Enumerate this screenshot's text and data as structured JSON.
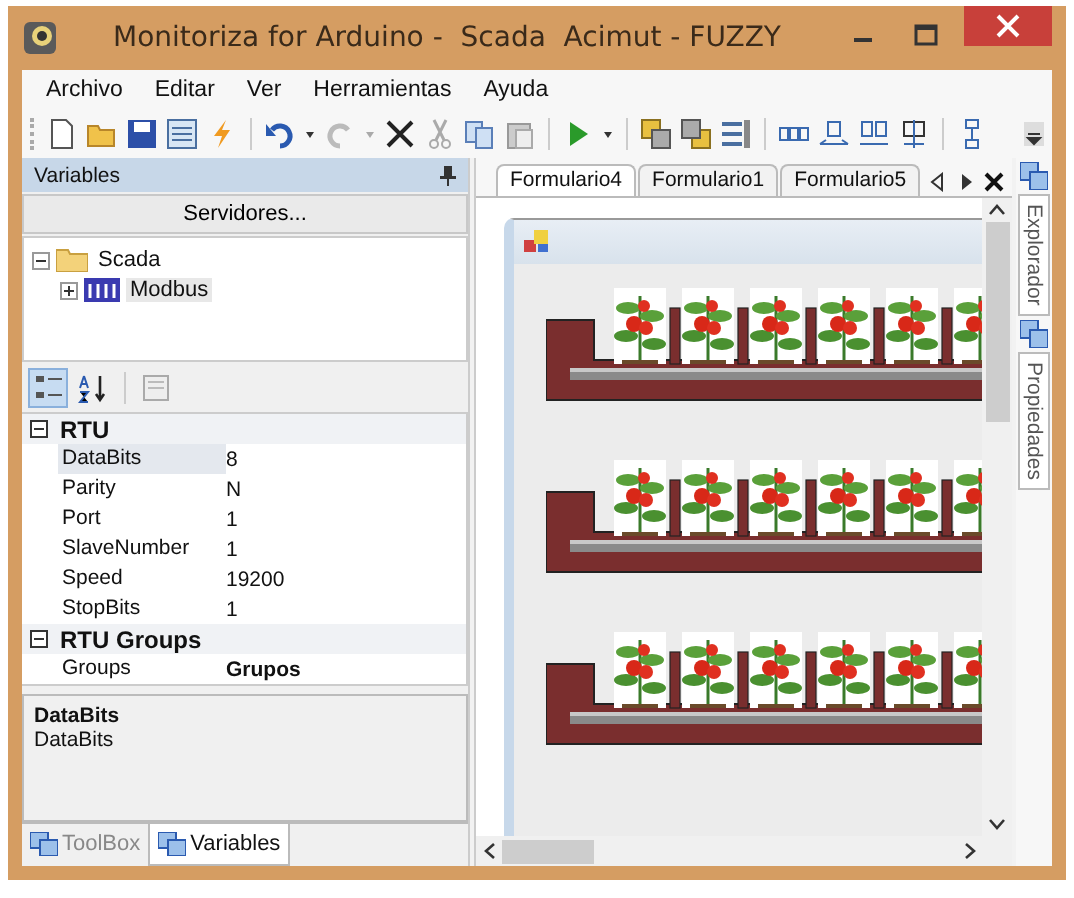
{
  "window": {
    "title": "Monitoriza for Arduino -  Scada  Acimut - FUZZY"
  },
  "menu": [
    "Archivo",
    "Editar",
    "Ver",
    "Herramientas",
    "Ayuda"
  ],
  "variables_panel": {
    "title": "Variables",
    "button": "Servidores...",
    "tree": [
      {
        "label": "Scada",
        "expanded": true,
        "selected": false,
        "children": [
          {
            "label": "Modbus",
            "expanded": false,
            "selected": true
          }
        ]
      }
    ],
    "grid_modes": [
      {
        "kind": "categorized",
        "selected": true
      },
      {
        "kind": "alphabetical",
        "selected": false
      },
      {
        "kind": "pages",
        "selected": false
      }
    ],
    "categories": [
      {
        "name": "RTU",
        "expanded": true,
        "properties": [
          {
            "name": "DataBits",
            "value": "8",
            "selected": true
          },
          {
            "name": "Parity",
            "value": "N",
            "selected": false
          },
          {
            "name": "Port",
            "value": "1",
            "selected": false
          },
          {
            "name": "SlaveNumber",
            "value": "1",
            "selected": false
          },
          {
            "name": "Speed",
            "value": "19200",
            "selected": false
          },
          {
            "name": "StopBits",
            "value": "1",
            "selected": false
          }
        ]
      },
      {
        "name": "RTU Groups",
        "expanded": true,
        "properties": [
          {
            "name": "Groups",
            "value": "Grupos",
            "selected": false,
            "bold": true
          }
        ]
      }
    ],
    "description": {
      "title": "DataBits",
      "text": "DataBits"
    },
    "bottom_tabs": [
      {
        "label": "ToolBox",
        "selected": false
      },
      {
        "label": "Variables",
        "selected": true
      }
    ]
  },
  "document_tabs": [
    {
      "label": "Formulario4",
      "selected": true
    },
    {
      "label": "Formulario1",
      "selected": false
    },
    {
      "label": "Formulario5",
      "selected": false
    }
  ],
  "side_tabs": [
    {
      "label": "Explorador"
    },
    {
      "label": "Propiedades"
    }
  ]
}
